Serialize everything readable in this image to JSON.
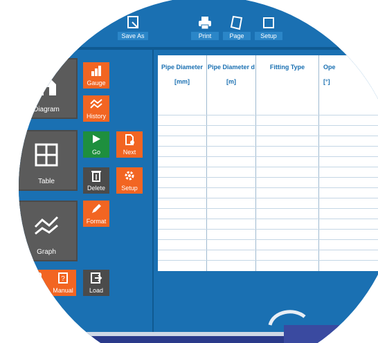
{
  "toolbar": {
    "save_as": "Save As",
    "print": "Print",
    "page": "Page",
    "setup": "Setup"
  },
  "left": {
    "diagram": "Diagram",
    "table": "Table",
    "graph": "Graph",
    "gauge": "Gauge",
    "history": "History",
    "go": "Go",
    "next": "Next",
    "delete": "Delete",
    "setup": "Setup",
    "format": "Format",
    "manual": "Manual",
    "load": "Load"
  },
  "table": {
    "columns": [
      {
        "name": "Pipe Diameter",
        "unit": "[mm]"
      },
      {
        "name": "Pipe Diameter d",
        "unit": "[m]"
      },
      {
        "name": "Fitting Type",
        "unit": ""
      },
      {
        "name": "Ope",
        "unit": "[°]"
      }
    ]
  },
  "colors": {
    "panel_blue": "#1a70b2",
    "orange": "#f26522",
    "green": "#1e8f3e",
    "grey": "#5b5b5b"
  }
}
